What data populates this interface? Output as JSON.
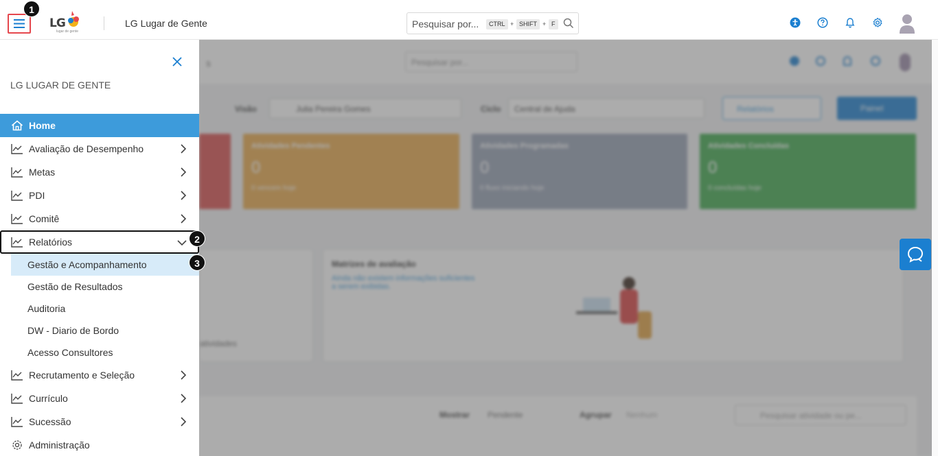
{
  "header": {
    "app_title": "LG Lugar de Gente",
    "logo_text": "LG",
    "logo_subtext": "lugar de gente",
    "search": {
      "placeholder": "Pesquisar por...",
      "keys": [
        "CTRL",
        "SHIFT",
        "F"
      ],
      "separator": "+"
    },
    "icons": [
      "accessibility-icon",
      "help-icon",
      "bell-icon",
      "gear-icon",
      "user-avatar"
    ],
    "accent_color": "#1b7fd0"
  },
  "drawer": {
    "company": "LG LUGAR DE GENTE",
    "items": [
      {
        "label": "Home",
        "icon": "home-icon",
        "active": true
      },
      {
        "label": "Avaliação de Desempenho",
        "icon": "chart-line-icon"
      },
      {
        "label": "Metas",
        "icon": "chart-line-icon"
      },
      {
        "label": "PDI",
        "icon": "chart-line-icon"
      },
      {
        "label": "Comitê",
        "icon": "chart-line-icon"
      },
      {
        "label": "Relatórios",
        "icon": "chart-line-icon",
        "expanded": true
      },
      {
        "label": "Recrutamento e Seleção",
        "icon": "chart-line-icon"
      },
      {
        "label": "Currículo",
        "icon": "chart-line-icon"
      },
      {
        "label": "Sucessão",
        "icon": "chart-line-icon"
      },
      {
        "label": "Administração",
        "icon": "gear-icon"
      }
    ],
    "relatorios_sub": [
      {
        "label": "Gestão e Acompanhamento",
        "selected": true
      },
      {
        "label": "Gestão de Resultados"
      },
      {
        "label": "Auditoria"
      },
      {
        "label": "DW - Diario de Bordo"
      },
      {
        "label": "Acesso Consultores"
      }
    ],
    "active_color": "#3d9bdb",
    "selected_sub_color": "#d7ebf9"
  },
  "annotations": [
    "1",
    "2",
    "3"
  ],
  "background": {
    "visao_label": "Visão",
    "visao_value": "Julia Pereira Gomes",
    "ciclo_label": "Ciclo",
    "ciclo_value": "Central de Ajuda",
    "relatorios_btn": "Relatórios",
    "painel_btn": "Painel",
    "cards": [
      {
        "label": "Atividades Pendentes",
        "value": "0",
        "sub": "0 vencem hoje",
        "color": "#e8a94b"
      },
      {
        "label": "Atividades Programadas",
        "value": "0",
        "sub": "0 fluxo iniciando hoje",
        "color": "#95a0b3"
      },
      {
        "label": "Atividades Concluídas",
        "value": "0",
        "sub": "0 concluídas hoje",
        "color": "#3ea84d"
      }
    ],
    "first_card_color": "#d94f4f",
    "matrix_title": "Matrizes de avaliação",
    "matrix_text": "Ainda não existem informações suficientes a serem exibidas.",
    "left_panel_text": "atividades",
    "mostrar_label": "Mostrar",
    "mostrar_value": "Pendente",
    "agrupar_label": "Agrupar",
    "agrupar_value": "Nenhum",
    "activity_search": "Pesquisar atividade ou pe..."
  }
}
